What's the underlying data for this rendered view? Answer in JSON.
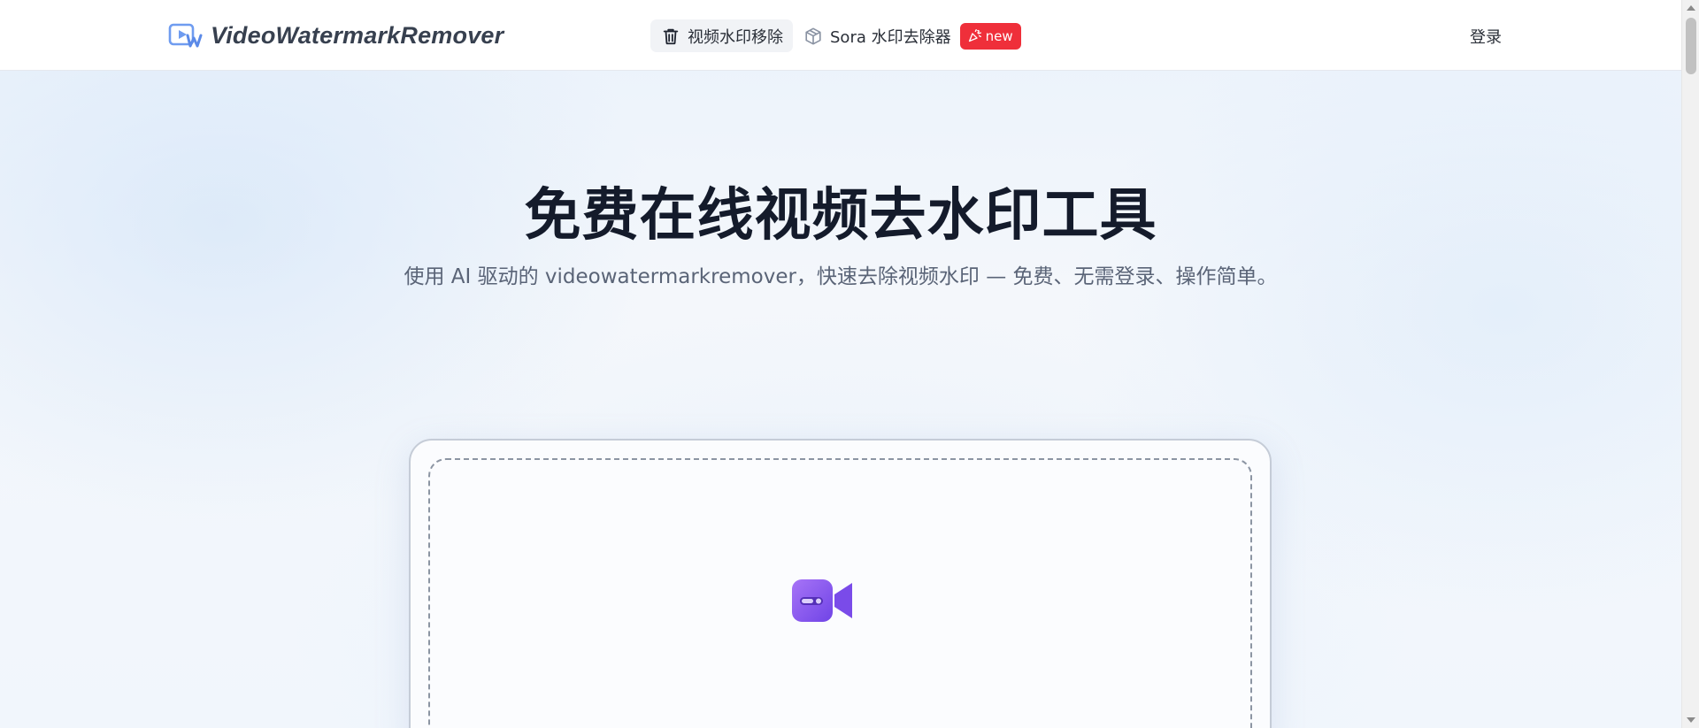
{
  "header": {
    "brand_name": "VideoWatermarkRemover",
    "nav": {
      "active_tab_label": "视频水印移除",
      "sora_tab_label": "Sora 水印去除器",
      "new_badge": "new"
    },
    "login_label": "登录"
  },
  "hero": {
    "title": "免费在线视频去水印工具",
    "subtitle": "使用 AI 驱动的 videowatermarkremover，快速去除视频水印 — 免费、无需登录、操作简单。"
  },
  "icons": {
    "brand_logo": "play-w-logo-icon",
    "active_tab": "trash-icon",
    "sora_tab": "cube-icon",
    "new_badge": "party-popper-icon",
    "upload": "video-camera-icon"
  },
  "colors": {
    "badge_red": "#ef2f3a",
    "title_dark": "#141b2b",
    "brand_blue": "#6f9cf0",
    "video_purple": "#8b5cf6"
  }
}
